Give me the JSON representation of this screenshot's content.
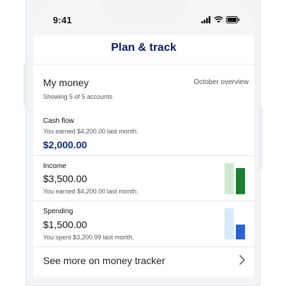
{
  "status": {
    "time": "9:41"
  },
  "header": {
    "title": "Plan & track"
  },
  "my_money": {
    "title": "My money",
    "overview_link": "October overview",
    "accounts_count": "Showing 5 of 5 accounts"
  },
  "cash_flow": {
    "label": "Cash flow",
    "subtitle": "You earned $4,200.00 last month.",
    "amount": "$2,000.00"
  },
  "income": {
    "label": "Income",
    "amount": "$3,500.00",
    "subtitle": "You earned $4,200.00 last month.",
    "bars": {
      "previous": 4200,
      "current": 3500,
      "previous_color": "#cfe8d2",
      "current_color": "#1a7f2e"
    }
  },
  "spending": {
    "label": "Spending",
    "amount": "$1,500.00",
    "subtitle": "You spent $3,200.99 last month.",
    "bars": {
      "previous": 3200.99,
      "current": 1500,
      "previous_color": "#d9e8fb",
      "current_color": "#2a62d6"
    }
  },
  "footer_link": {
    "label": "See more on money tracker",
    "icon": "chevron-right-icon"
  },
  "icons": [
    "signal-icon",
    "wifi-icon",
    "battery-icon"
  ]
}
